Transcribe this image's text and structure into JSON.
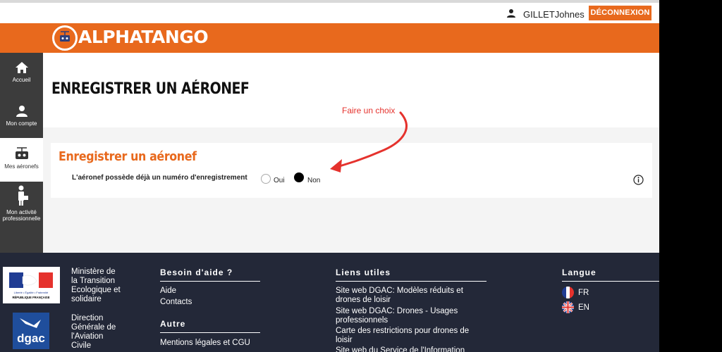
{
  "topbar": {
    "user_name": "GILLETJohnes",
    "logout_label": "DÉCONNEXION"
  },
  "header": {
    "logo_text": "ALPHATANGO"
  },
  "sidebar": {
    "items": [
      {
        "label": "Accueil",
        "icon": "home-icon"
      },
      {
        "label": "Mon compte",
        "icon": "person-icon"
      },
      {
        "label": "Mes aéronefs",
        "icon": "drone-icon"
      },
      {
        "label": "Mon activité professionnelle",
        "icon": "briefcase-person-icon"
      }
    ]
  },
  "main": {
    "page_title": "ENREGISTRER UN AÉRONEF",
    "annotation": "Faire un choix",
    "card": {
      "title": "Enregistrer un aéronef",
      "question": "L'aéronef possède déjà un numéro d'enregistrement",
      "option_yes": "Oui",
      "option_no": "Non",
      "selected": "Non"
    }
  },
  "footer": {
    "rf_logo_text": [
      "Liberté • Égalité • Fraternité",
      "RÉPUBLIQUE FRANÇAISE"
    ],
    "ministry": [
      "Ministère de",
      "la Transition",
      "Ecologique et",
      "solidaire"
    ],
    "dgac_logo_text": "dgac",
    "direction": [
      "Direction",
      "Générale de",
      "l'Aviation",
      "Civile"
    ],
    "help_heading": "Besoin d'aide ?",
    "help_links": [
      "Aide",
      "Contacts"
    ],
    "other_heading": "Autre",
    "other_links": [
      "Mentions légales et CGU"
    ],
    "useful_heading": "Liens utiles",
    "useful_links": [
      [
        "Site web DGAC: Modèles réduits et",
        "drones de loisir"
      ],
      [
        "Site web DGAC: Drones - Usages",
        "professionnels"
      ],
      [
        "Carte des restrictions pour drones de",
        "loisir"
      ],
      [
        "Site web du Service de l'Information"
      ]
    ],
    "lang_heading": "Langue",
    "languages": [
      "FR",
      "EN"
    ]
  },
  "colors": {
    "brand_orange": "#e8691d",
    "sidebar_bg": "#3c3c3c",
    "footer_bg": "#232838",
    "annotation_red": "#e5322d"
  }
}
